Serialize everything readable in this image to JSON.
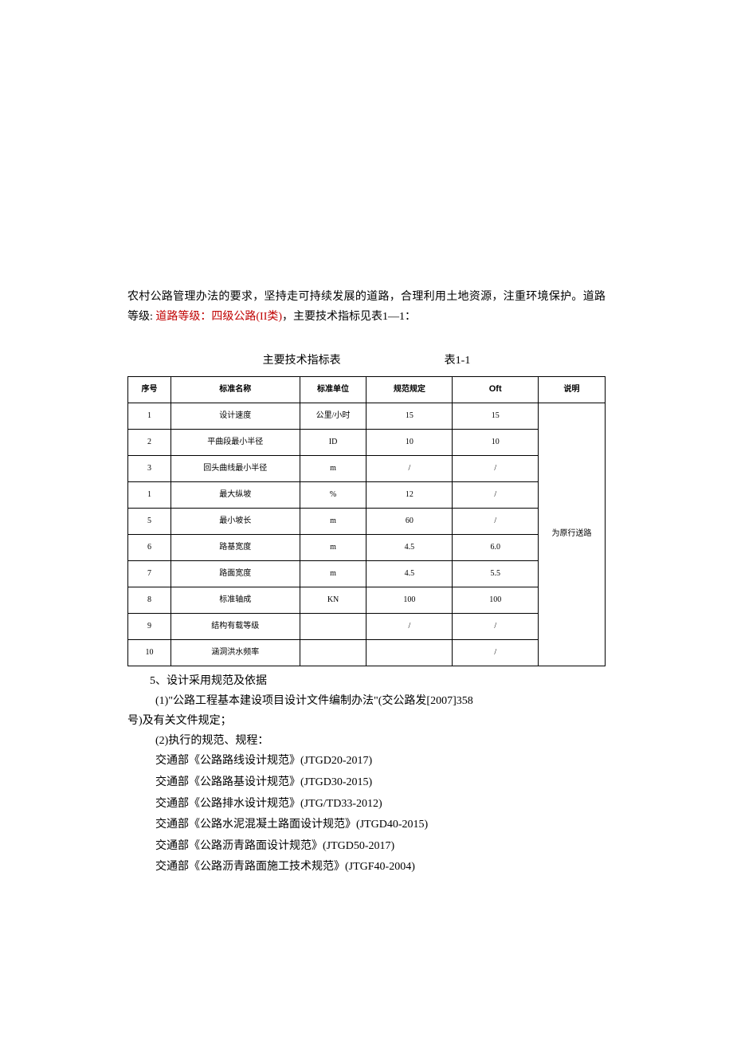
{
  "intro": {
    "part1": "农村公路管理办法的要求，坚持走可持续发展的道路，合理利用土地资源，注重环境保护。道路等级: ",
    "red": "道路等级：四级公路(II类)",
    "part2": "，主要技术指标见表1—1："
  },
  "table": {
    "title": "主要技术指标表",
    "number": "表1-1",
    "headers": {
      "seq": "序号",
      "name": "标准名称",
      "unit": "标准单位",
      "spec": "规范规定",
      "oft": "Oft",
      "note": "说明"
    },
    "note_merged": "为原行送路",
    "rows": [
      {
        "seq": "1",
        "name": "设计速度",
        "unit": "公里/小时",
        "spec": "15",
        "oft": "15"
      },
      {
        "seq": "2",
        "name": "平曲段最小半径",
        "unit": "ID",
        "spec": "10",
        "oft": "10"
      },
      {
        "seq": "3",
        "name": "回头曲线最小半径",
        "unit": "m",
        "spec": "/",
        "oft": "/"
      },
      {
        "seq": "1",
        "name": "最大纵坡",
        "unit": "%",
        "spec": "12",
        "oft": "/"
      },
      {
        "seq": "5",
        "name": "最小坡长",
        "unit": "m",
        "spec": "60",
        "oft": "/"
      },
      {
        "seq": "6",
        "name": "路基宽度",
        "unit": "m",
        "spec": "4.5",
        "oft": "6.0"
      },
      {
        "seq": "7",
        "name": "路面宽度",
        "unit": "m",
        "spec": "4.5",
        "oft": "5.5"
      },
      {
        "seq": "8",
        "name": "标准轴成",
        "unit": "KN",
        "spec": "100",
        "oft": "100"
      },
      {
        "seq": "9",
        "name": "结构有载等级",
        "unit": "",
        "spec": "/",
        "oft": "/"
      },
      {
        "seq": "10",
        "name": "涵洞洪水频率",
        "unit": "",
        "spec": "",
        "oft": "/"
      }
    ]
  },
  "section5": {
    "title": "5、设计采用规范及依据",
    "item1_line1": "(1)\"公路工程基本建设项目设计文件编制办法\"(交公路发[2007]358",
    "item1_line2": "号)及有关文件规定；",
    "item2": "(2)执行的规范、规程：",
    "specs": [
      "交通部《公路路线设计规范》(JTGD20-2017)",
      "交通部《公路路基设计规范》(JTGD30-2015)",
      "交通部《公路排水设计规范》(JTG/TD33-2012)",
      "交通部《公路水泥混凝土路面设计规范》(JTGD40-2015)",
      "交通部《公路沥青路面设计规范》(JTGD50-2017)",
      "交通部《公路沥青路面施工技术规范》(JTGF40-2004)"
    ]
  }
}
